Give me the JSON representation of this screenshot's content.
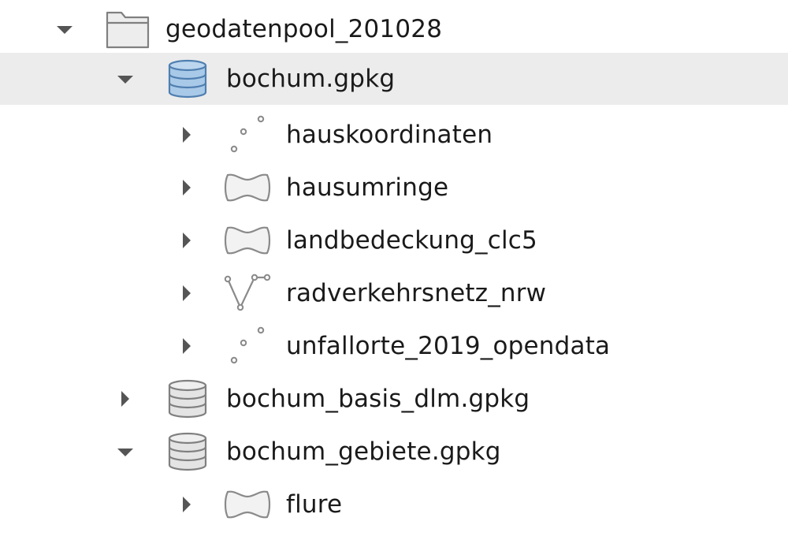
{
  "colors": {
    "selected_row_bg": "#ececec",
    "selected_db_icon_fill": "#a9c9e8",
    "selected_db_icon_stroke": "#4f7fb0",
    "db_icon_fill": "#e4e4e4",
    "icon_stroke": "#808080",
    "text": "#1a1a1a"
  },
  "tree": {
    "folder": {
      "label": "geodatenpool_201028",
      "icon": "folder-icon",
      "expanded": true
    },
    "databases": [
      {
        "label": "bochum.gpkg",
        "icon": "database-icon",
        "expanded": true,
        "selected": true,
        "layers": [
          {
            "label": "hauskoordinaten",
            "icon": "point-layer-icon"
          },
          {
            "label": "hausumringe",
            "icon": "polygon-layer-icon"
          },
          {
            "label": "landbedeckung_clc5",
            "icon": "polygon-layer-icon"
          },
          {
            "label": "radverkehrsnetz_nrw",
            "icon": "line-layer-icon"
          },
          {
            "label": "unfallorte_2019_opendata",
            "icon": "point-layer-icon"
          }
        ]
      },
      {
        "label": "bochum_basis_dlm.gpkg",
        "icon": "database-icon",
        "expanded": false,
        "selected": false,
        "layers": []
      },
      {
        "label": "bochum_gebiete.gpkg",
        "icon": "database-icon",
        "expanded": true,
        "selected": false,
        "layers": [
          {
            "label": "flure",
            "icon": "polygon-layer-icon"
          }
        ]
      }
    ]
  }
}
